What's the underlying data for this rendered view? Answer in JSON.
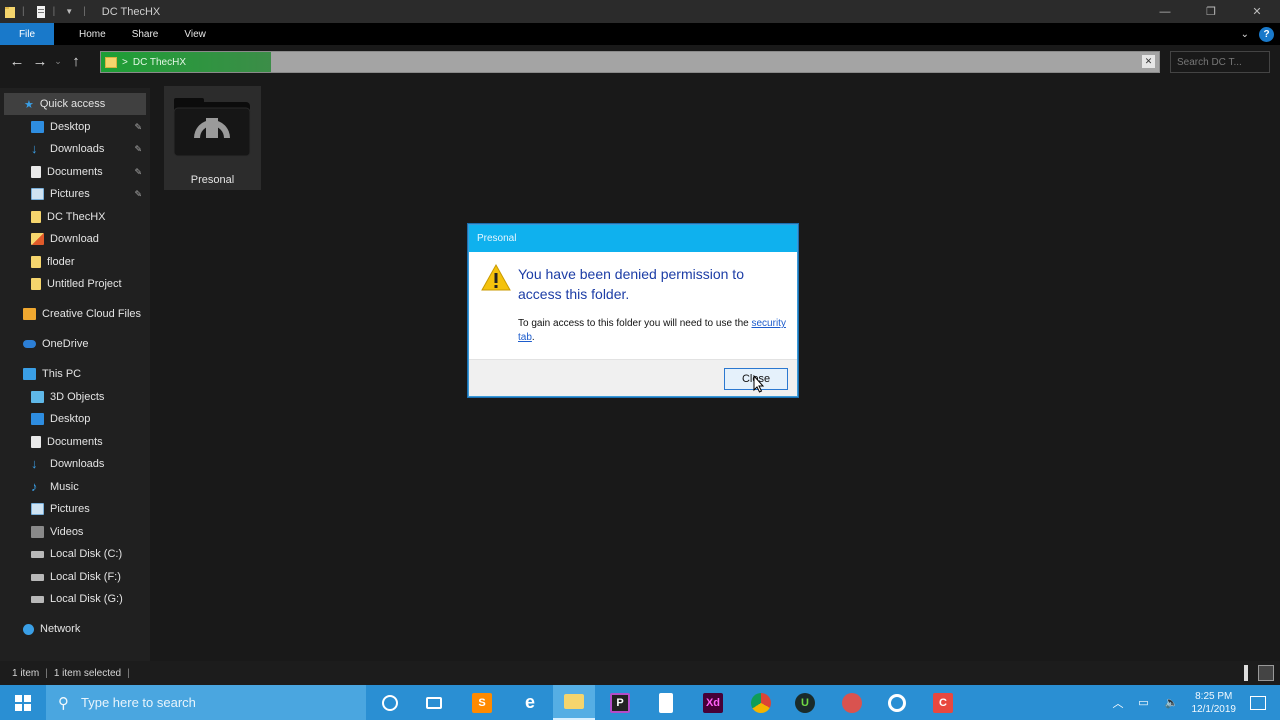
{
  "window": {
    "title": "DC ThecHX",
    "controls": {
      "minimize": "—",
      "maximize": "❐",
      "close": "✕"
    }
  },
  "ribbon": {
    "tabs": [
      "File",
      "Home",
      "Share",
      "View"
    ],
    "expand_icon": "chevron-down-icon",
    "help_icon": "?"
  },
  "navigation": {
    "back": "←",
    "forward": "→",
    "recent": "⌄",
    "up": "↑",
    "breadcrumb_sep": ">",
    "path": "DC ThecHX",
    "clear": "✕",
    "search_placeholder": "Search DC T..."
  },
  "sidebar": {
    "quick_access": "Quick access",
    "quick_items": [
      {
        "label": "Desktop",
        "pinned": true
      },
      {
        "label": "Downloads",
        "pinned": true
      },
      {
        "label": "Documents",
        "pinned": true
      },
      {
        "label": "Pictures",
        "pinned": true
      },
      {
        "label": "DC ThecHX",
        "pinned": false
      },
      {
        "label": "Download",
        "pinned": false
      },
      {
        "label": "floder",
        "pinned": false
      },
      {
        "label": "Untitled Project",
        "pinned": false
      }
    ],
    "creative_cloud": "Creative Cloud Files",
    "onedrive": "OneDrive",
    "this_pc": "This PC",
    "pc_items": [
      "3D Objects",
      "Desktop",
      "Documents",
      "Downloads",
      "Music",
      "Pictures",
      "Videos",
      "Local Disk (C:)",
      "Local Disk (F:)",
      "Local Disk (G:)"
    ],
    "network": "Network"
  },
  "content": {
    "folder_name": "Presonal"
  },
  "dialog": {
    "title": "Presonal",
    "message": "You have been denied permission to access this folder.",
    "detail": "To gain access to this folder you will need to use the",
    "link": "security tab",
    "link_suffix": ".",
    "close_label": "Close"
  },
  "status": {
    "items": "1 item",
    "selected": "1 item selected"
  },
  "taskbar": {
    "search_placeholder": "Type here to search",
    "time": "8:25 PM",
    "date": "12/1/2019",
    "apps": [
      "cortana-icon",
      "task-view-icon",
      "sublime-text-icon",
      "edge-icon",
      "file-explorer-icon",
      "jetbrains-icon",
      "file-icon",
      "adobe-xd-icon",
      "chrome-icon",
      "upwork-icon",
      "photos-icon",
      "obs-icon",
      "camtasia-icon"
    ]
  },
  "colors": {
    "accent": "#1979ca",
    "taskbar": "#2a8fd3",
    "dialog_title": "#0fb1ee",
    "address_progress": "#1d9f35",
    "dialog_text": "#1c3da6"
  }
}
